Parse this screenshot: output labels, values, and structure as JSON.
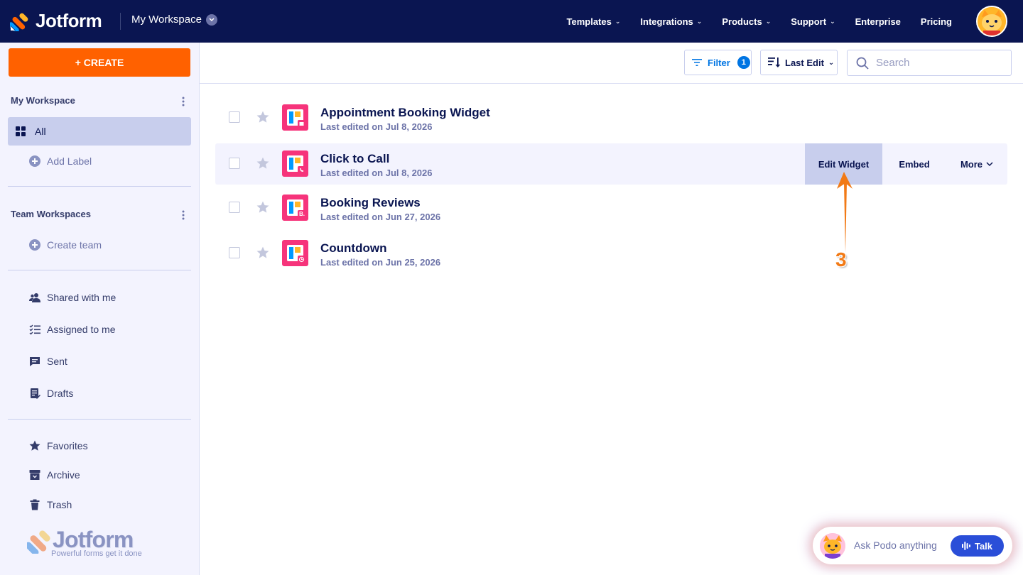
{
  "topbar": {
    "logo_text": "Jotform",
    "workspace_name": "My Workspace",
    "nav": [
      {
        "label": "Templates",
        "has_chevron": true
      },
      {
        "label": "Integrations",
        "has_chevron": true
      },
      {
        "label": "Products",
        "has_chevron": true
      },
      {
        "label": "Support",
        "has_chevron": true
      },
      {
        "label": "Enterprise",
        "has_chevron": false
      },
      {
        "label": "Pricing",
        "has_chevron": false
      }
    ]
  },
  "sidebar": {
    "create_label": "+ CREATE",
    "my_workspace_title": "My Workspace",
    "all_label": "All",
    "add_label": "Add Label",
    "team_workspaces_title": "Team Workspaces",
    "create_team_label": "Create team",
    "shared_label": "Shared with me",
    "assigned_label": "Assigned to me",
    "sent_label": "Sent",
    "drafts_label": "Drafts",
    "favorites_label": "Favorites",
    "archive_label": "Archive",
    "trash_label": "Trash",
    "brand_text": "Jotform",
    "brand_tagline": "Powerful forms get it done"
  },
  "toolbar": {
    "filter_label": "Filter",
    "filter_count": "1",
    "sort_label": "Last Edit",
    "search_placeholder": "Search"
  },
  "widgets": [
    {
      "title": "Appointment Booking Widget",
      "subtitle": "Last edited on Jul 8, 2026",
      "badge": "calendar"
    },
    {
      "title": "Click to Call",
      "subtitle": "Last edited on Jul 8, 2026",
      "badge": "phone"
    },
    {
      "title": "Booking Reviews",
      "subtitle": "Last edited on Jun 27, 2026",
      "badge": "B."
    },
    {
      "title": "Countdown",
      "subtitle": "Last edited on Jun 25, 2026",
      "badge": "clock"
    }
  ],
  "row_actions": {
    "edit_label": "Edit Widget",
    "embed_label": "Embed",
    "more_label": "More"
  },
  "annotation": {
    "step_number": "3"
  },
  "podo": {
    "prompt": "Ask Podo anything",
    "talk_label": "Talk"
  },
  "colors": {
    "nav_bg": "#0a1551",
    "create": "#ff6100",
    "accent_blue": "#0075e3",
    "widget_icon": "#f6347b",
    "annotation": "#f27a16"
  }
}
